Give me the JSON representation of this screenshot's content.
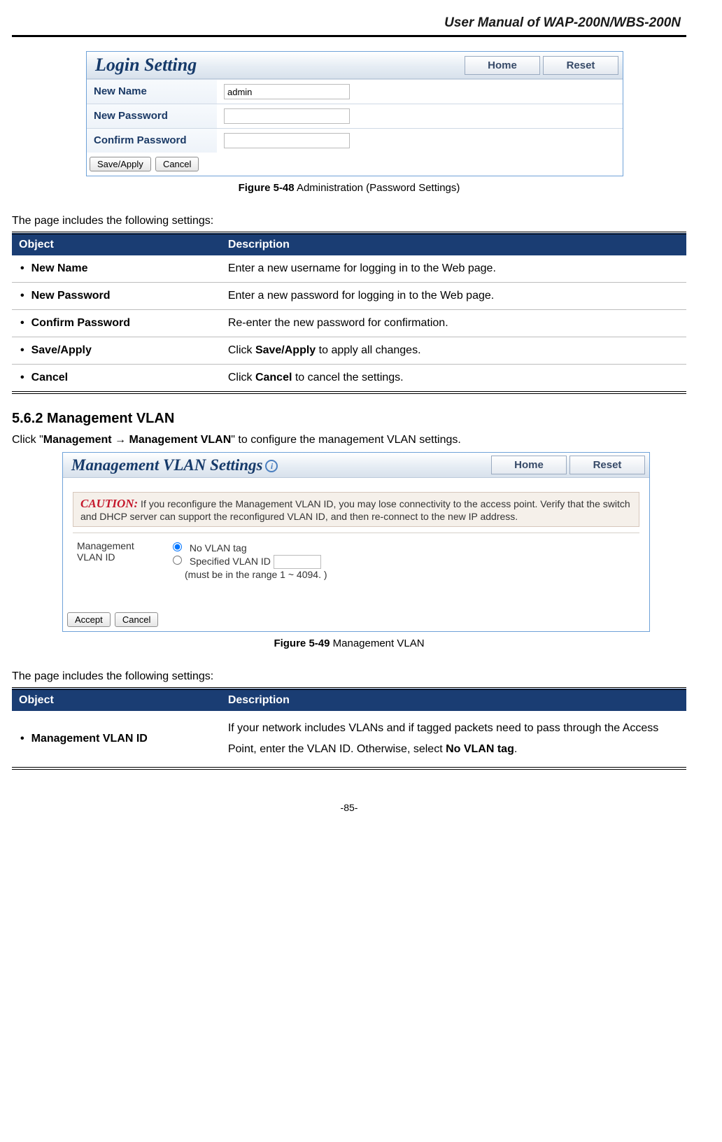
{
  "header": {
    "title": "User Manual of WAP-200N/WBS-200N"
  },
  "figure_login": {
    "title": "Login Setting",
    "home_btn": "Home",
    "reset_btn": "Reset",
    "rows": {
      "new_name_label": "New Name",
      "new_name_value": "admin",
      "new_password_label": "New Password",
      "confirm_password_label": "Confirm Password"
    },
    "save_apply_btn": "Save/Apply",
    "cancel_btn": "Cancel",
    "caption_bold": "Figure 5-48",
    "caption_rest": " Administration (Password Settings)"
  },
  "lead1": "The page includes the following settings:",
  "table1": {
    "head_obj": "Object",
    "head_desc": "Description",
    "rows": [
      {
        "obj": "New Name",
        "desc": "Enter a new username for logging in to the Web page."
      },
      {
        "obj": "New Password",
        "desc": "Enter a new password for logging in to the Web page."
      },
      {
        "obj": "Confirm Password",
        "desc": "Re-enter the new password for confirmation."
      },
      {
        "obj": "Save/Apply",
        "desc_pre": "Click ",
        "desc_bold": "Save/Apply",
        "desc_post": " to apply all changes."
      },
      {
        "obj": "Cancel",
        "desc_pre": "Click ",
        "desc_bold": "Cancel",
        "desc_post": " to cancel the settings."
      }
    ]
  },
  "section_562": "5.6.2   Management VLAN",
  "click_line_pre": "Click \"",
  "click_line_bold": "Management → Management VLAN",
  "click_line_post": "\" to configure the management VLAN settings.",
  "figure_vlan": {
    "title": "Management VLAN Settings",
    "home_btn": "Home",
    "reset_btn": "Reset",
    "caution_label": "CAUTION:",
    "caution_text": " If you reconfigure the Management VLAN ID, you may lose connectivity to the access point. Verify that the switch and DHCP server can support the reconfigured VLAN ID, and then re-connect to the new IP address.",
    "vlan_label": "Management VLAN ID",
    "opt_no_tag": "No VLAN tag",
    "opt_specified": "Specified VLAN ID",
    "range_note": "(must be in the range 1 ~ 4094. )",
    "accept_btn": "Accept",
    "cancel_btn": "Cancel",
    "caption_bold": "Figure 5-49",
    "caption_rest": " Management VLAN"
  },
  "lead2": "The page includes the following settings:",
  "table2": {
    "head_obj": "Object",
    "head_desc": "Description",
    "rows": [
      {
        "obj": "Management VLAN ID",
        "desc_pre": "If your network includes VLANs and if tagged packets need to pass through the Access Point, enter the VLAN ID. Otherwise, select ",
        "desc_bold": "No VLAN tag",
        "desc_post": "."
      }
    ]
  },
  "pagenum": "-85-"
}
